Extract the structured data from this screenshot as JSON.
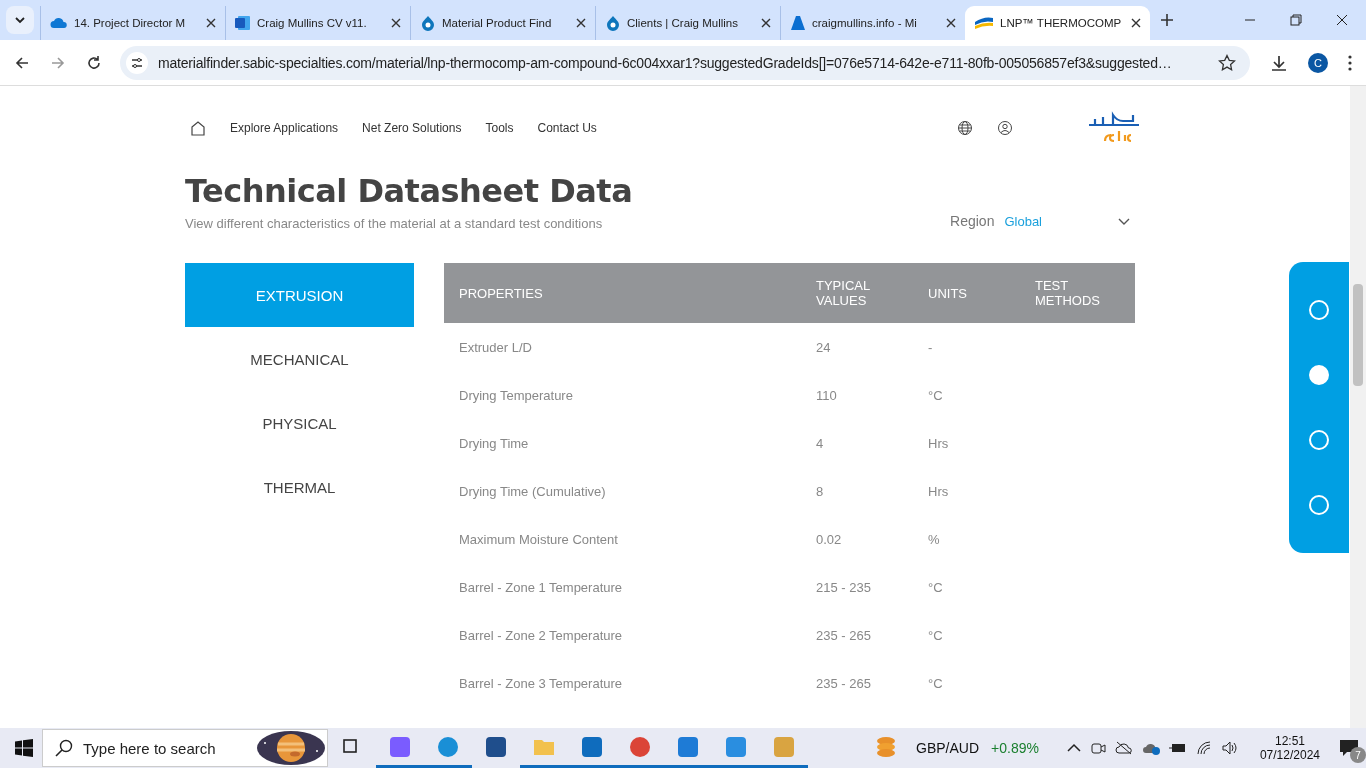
{
  "browser": {
    "tabs": [
      {
        "title": "14. Project Director M",
        "kind": "cloud",
        "selected": false
      },
      {
        "title": "Craig Mullins CV v11.",
        "kind": "word",
        "selected": false
      },
      {
        "title": "Material Product Find",
        "kind": "drop",
        "selected": false
      },
      {
        "title": "Clients | Craig Mullins",
        "kind": "drop",
        "selected": false
      },
      {
        "title": "craigmullins.info - Mi",
        "kind": "azure",
        "selected": false
      },
      {
        "title": "LNP™ THERMOCOMP",
        "kind": "wave",
        "selected": true
      }
    ],
    "address": "materialfinder.sabic-specialties.com/material/lnp-thermocomp-am-compound-6c004xxar1?suggestedGradeIds[]=076e5714-642e-e711-80fb-005056857ef3&suggested…",
    "profile": "C"
  },
  "nav": {
    "links": [
      "Explore Applications",
      "Net Zero Solutions",
      "Tools",
      "Contact Us"
    ]
  },
  "heading": {
    "title": "Technical Datasheet Data",
    "subtitle": "View different characteristics of the material at a standard test conditions",
    "region_label": "Region",
    "region_value": "Global"
  },
  "categories": [
    {
      "label": "EXTRUSION",
      "selected": true
    },
    {
      "label": "MECHANICAL",
      "selected": false
    },
    {
      "label": "PHYSICAL",
      "selected": false
    },
    {
      "label": "THERMAL",
      "selected": false
    }
  ],
  "table": {
    "columns": [
      "PROPERTIES",
      "TYPICAL VALUES",
      "UNITS",
      "TEST METHODS"
    ],
    "rows": [
      [
        "Extruder L/D",
        "24",
        "-"
      ],
      [
        "Drying Temperature",
        "110",
        "°C"
      ],
      [
        "Drying Time",
        "4",
        "Hrs"
      ],
      [
        "Drying Time (Cumulative)",
        "8",
        "Hrs"
      ],
      [
        "Maximum Moisture Content",
        "0.02",
        "%"
      ],
      [
        "Barrel - Zone 1 Temperature",
        "215 - 235",
        "°C"
      ],
      [
        "Barrel - Zone 2 Temperature",
        "235 - 265",
        "°C"
      ],
      [
        "Barrel - Zone 3 Temperature",
        "235 - 265",
        "°C"
      ]
    ]
  },
  "side_panel": [
    {
      "selected": false
    },
    {
      "selected": true
    },
    {
      "selected": false
    },
    {
      "selected": false
    }
  ],
  "taskbar": {
    "search_placeholder": "Type here to search",
    "apps": [
      {
        "kind": "taskview",
        "running": false
      },
      {
        "kind": "copilot",
        "running": true
      },
      {
        "kind": "edge",
        "running": true
      },
      {
        "kind": "store",
        "running": false
      },
      {
        "kind": "folder",
        "running": true
      },
      {
        "kind": "outlook",
        "running": true
      },
      {
        "kind": "chrome",
        "running": true
      },
      {
        "kind": "remote",
        "running": true
      },
      {
        "kind": "photos",
        "running": true
      },
      {
        "kind": "paint",
        "running": true
      }
    ],
    "ticker": "GBP/AUD",
    "change": "+0.89%",
    "time": "12:51",
    "date": "07/12/2024",
    "notifications": "7"
  }
}
